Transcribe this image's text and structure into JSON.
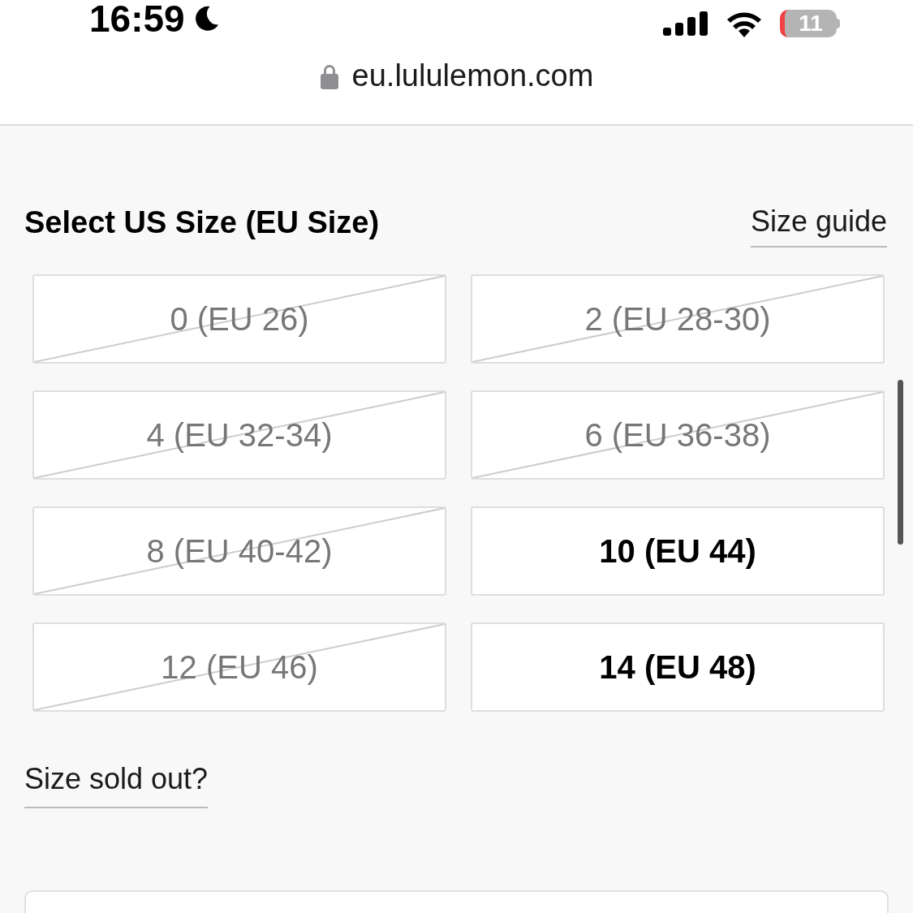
{
  "status_bar": {
    "time": "16:59",
    "battery": "11"
  },
  "address_bar": {
    "url": "eu.lululemon.com"
  },
  "size_picker": {
    "title": "Select US Size (EU Size)",
    "guide_link": "Size guide",
    "sizes": [
      {
        "label": "0 (EU 26)",
        "sold_out": true,
        "selected": false
      },
      {
        "label": "2 (EU 28-30)",
        "sold_out": true,
        "selected": false
      },
      {
        "label": "4 (EU 32-34)",
        "sold_out": true,
        "selected": false
      },
      {
        "label": "6 (EU 36-38)",
        "sold_out": true,
        "selected": false
      },
      {
        "label": "8 (EU 40-42)",
        "sold_out": true,
        "selected": false
      },
      {
        "label": "10 (EU 44)",
        "sold_out": false,
        "selected": false
      },
      {
        "label": "12 (EU 46)",
        "sold_out": true,
        "selected": false
      },
      {
        "label": "14 (EU 48)",
        "sold_out": false,
        "selected": false
      }
    ],
    "sold_out_link": "Size sold out?"
  }
}
